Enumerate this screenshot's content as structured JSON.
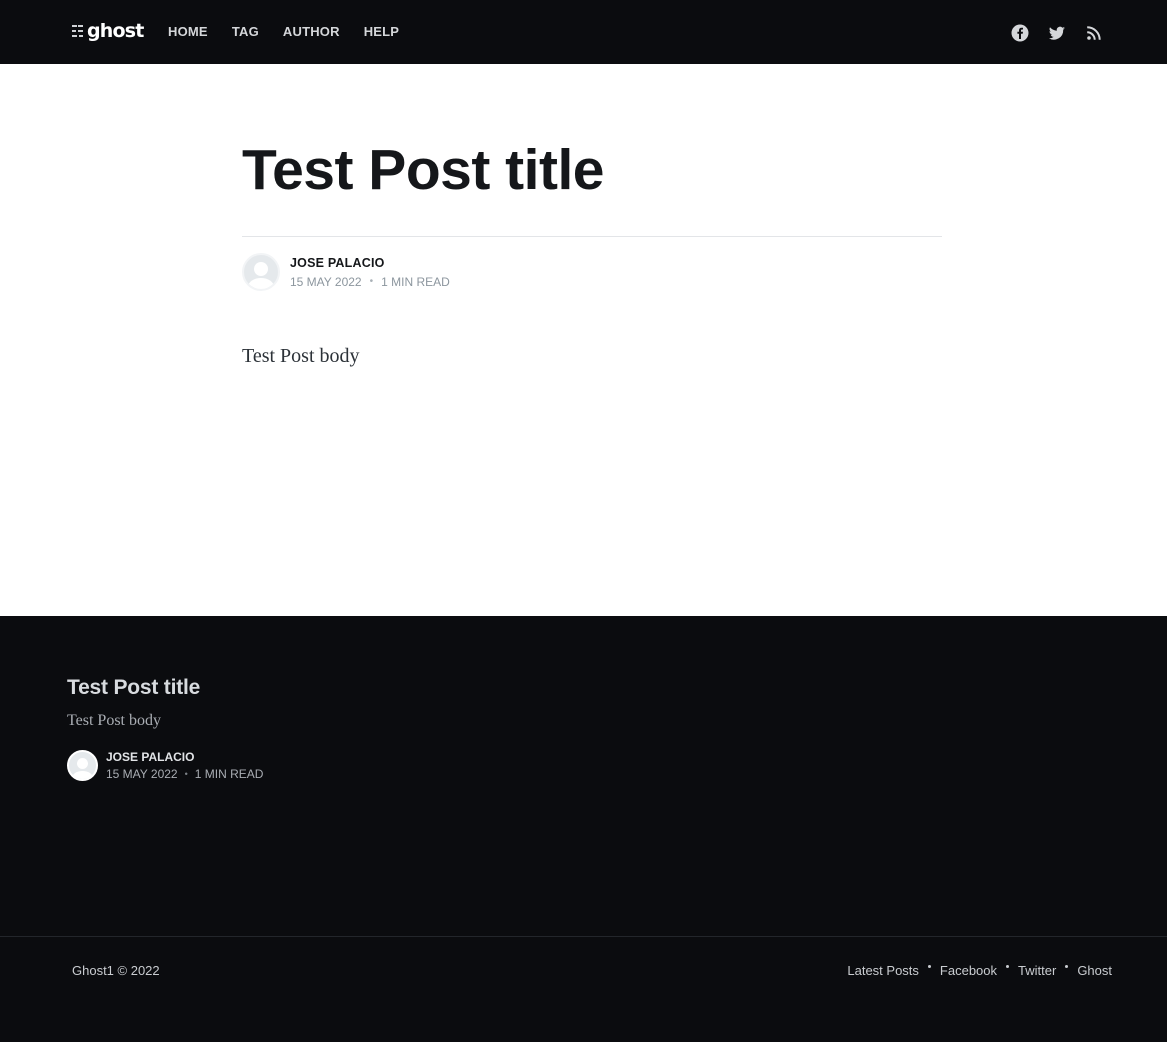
{
  "header": {
    "logo_text": "ghost",
    "nav": [
      {
        "label": "HOME"
      },
      {
        "label": "TAG"
      },
      {
        "label": "AUTHOR"
      },
      {
        "label": "HELP"
      }
    ],
    "social_icons": [
      "facebook-icon",
      "twitter-icon",
      "rss-icon"
    ]
  },
  "article": {
    "title": "Test Post title",
    "author": "JOSE PALACIO",
    "date": "15 MAY 2022",
    "reading_time": "1 MIN READ",
    "body": "Test Post body"
  },
  "read_next": {
    "title": "Test Post title",
    "excerpt": "Test Post body",
    "author": "JOSE PALACIO",
    "date": "15 MAY 2022",
    "reading_time": "1 MIN READ"
  },
  "footer": {
    "copyright": "Ghost1 © 2022",
    "links": [
      {
        "label": "Latest Posts"
      },
      {
        "label": "Facebook"
      },
      {
        "label": "Twitter"
      },
      {
        "label": "Ghost"
      }
    ]
  },
  "colors": {
    "dark_bg": "#0b0c0f",
    "title_text": "#15171a",
    "meta_text": "#8c969e"
  }
}
